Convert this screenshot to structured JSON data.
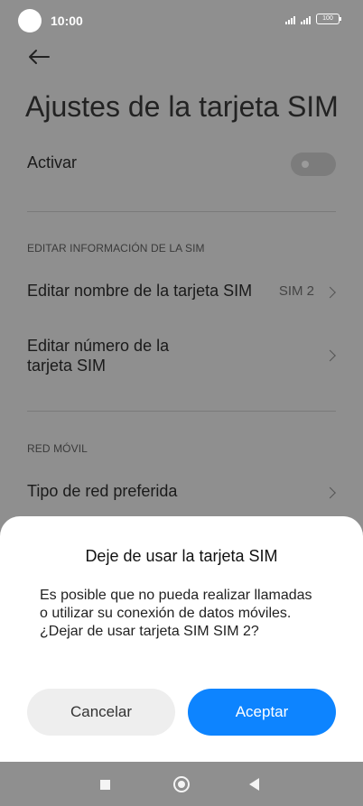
{
  "status_bar": {
    "time": "10:00",
    "battery": "100"
  },
  "page": {
    "title": "Ajustes de la tarjeta SIM"
  },
  "settings": {
    "activate_label": "Activar",
    "activate_on": false,
    "section_edit_label": "EDITAR INFORMACIÓN DE LA SIM",
    "edit_name_label": "Editar nombre de la tarjeta SIM",
    "edit_name_value": "SIM 2",
    "edit_number_label_line1": "Editar número de la",
    "edit_number_label_line2": "tarjeta SIM",
    "section_network_label": "RED MÓVIL",
    "network_type_label": "Tipo de red preferida"
  },
  "dialog": {
    "title": "Deje de usar la tarjeta SIM",
    "message": "Es posible que no pueda realizar llamadas o utilizar su conexión de datos móviles. ¿Dejar de usar tarjeta SIM SIM 2?",
    "cancel_label": "Cancelar",
    "accept_label": "Aceptar",
    "accept_color": "#0d84ff"
  }
}
